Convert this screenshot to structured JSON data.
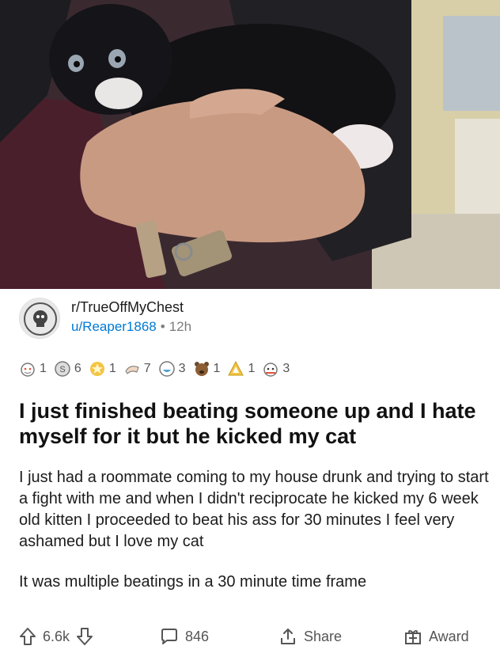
{
  "post": {
    "subreddit": "r/TrueOffMyChest",
    "user": "u/Reaper1868",
    "separator": "•",
    "age": "12h",
    "title": "I just finished beating someone up and I hate myself for it but he kicked my cat",
    "body": [
      "I just had a roommate coming to my house drunk and trying to start a fight with me and when I didn't reciprocate he kicked my 6 week old kitten I proceeded to beat his ass for 30 minutes I feel very ashamed but I love my cat",
      "It was multiple beatings in a 30 minute time frame"
    ]
  },
  "awards": [
    {
      "icon": "wholesome-snoo-icon",
      "count": "1"
    },
    {
      "icon": "silver-coin-icon",
      "count": "6"
    },
    {
      "icon": "gold-star-icon",
      "count": "1"
    },
    {
      "icon": "helpful-hands-icon",
      "count": "7"
    },
    {
      "icon": "laughing-face-icon",
      "count": "3"
    },
    {
      "icon": "bear-face-icon",
      "count": "1"
    },
    {
      "icon": "gold-triangle-icon",
      "count": "1"
    },
    {
      "icon": "snoo-hug-icon",
      "count": "3"
    }
  ],
  "actions": {
    "score": "6.6k",
    "comments": "846",
    "share": "Share",
    "award": "Award"
  },
  "colors": {
    "link": "#0079d3",
    "muted": "#7c7c7c",
    "text": "#1c1c1c"
  }
}
